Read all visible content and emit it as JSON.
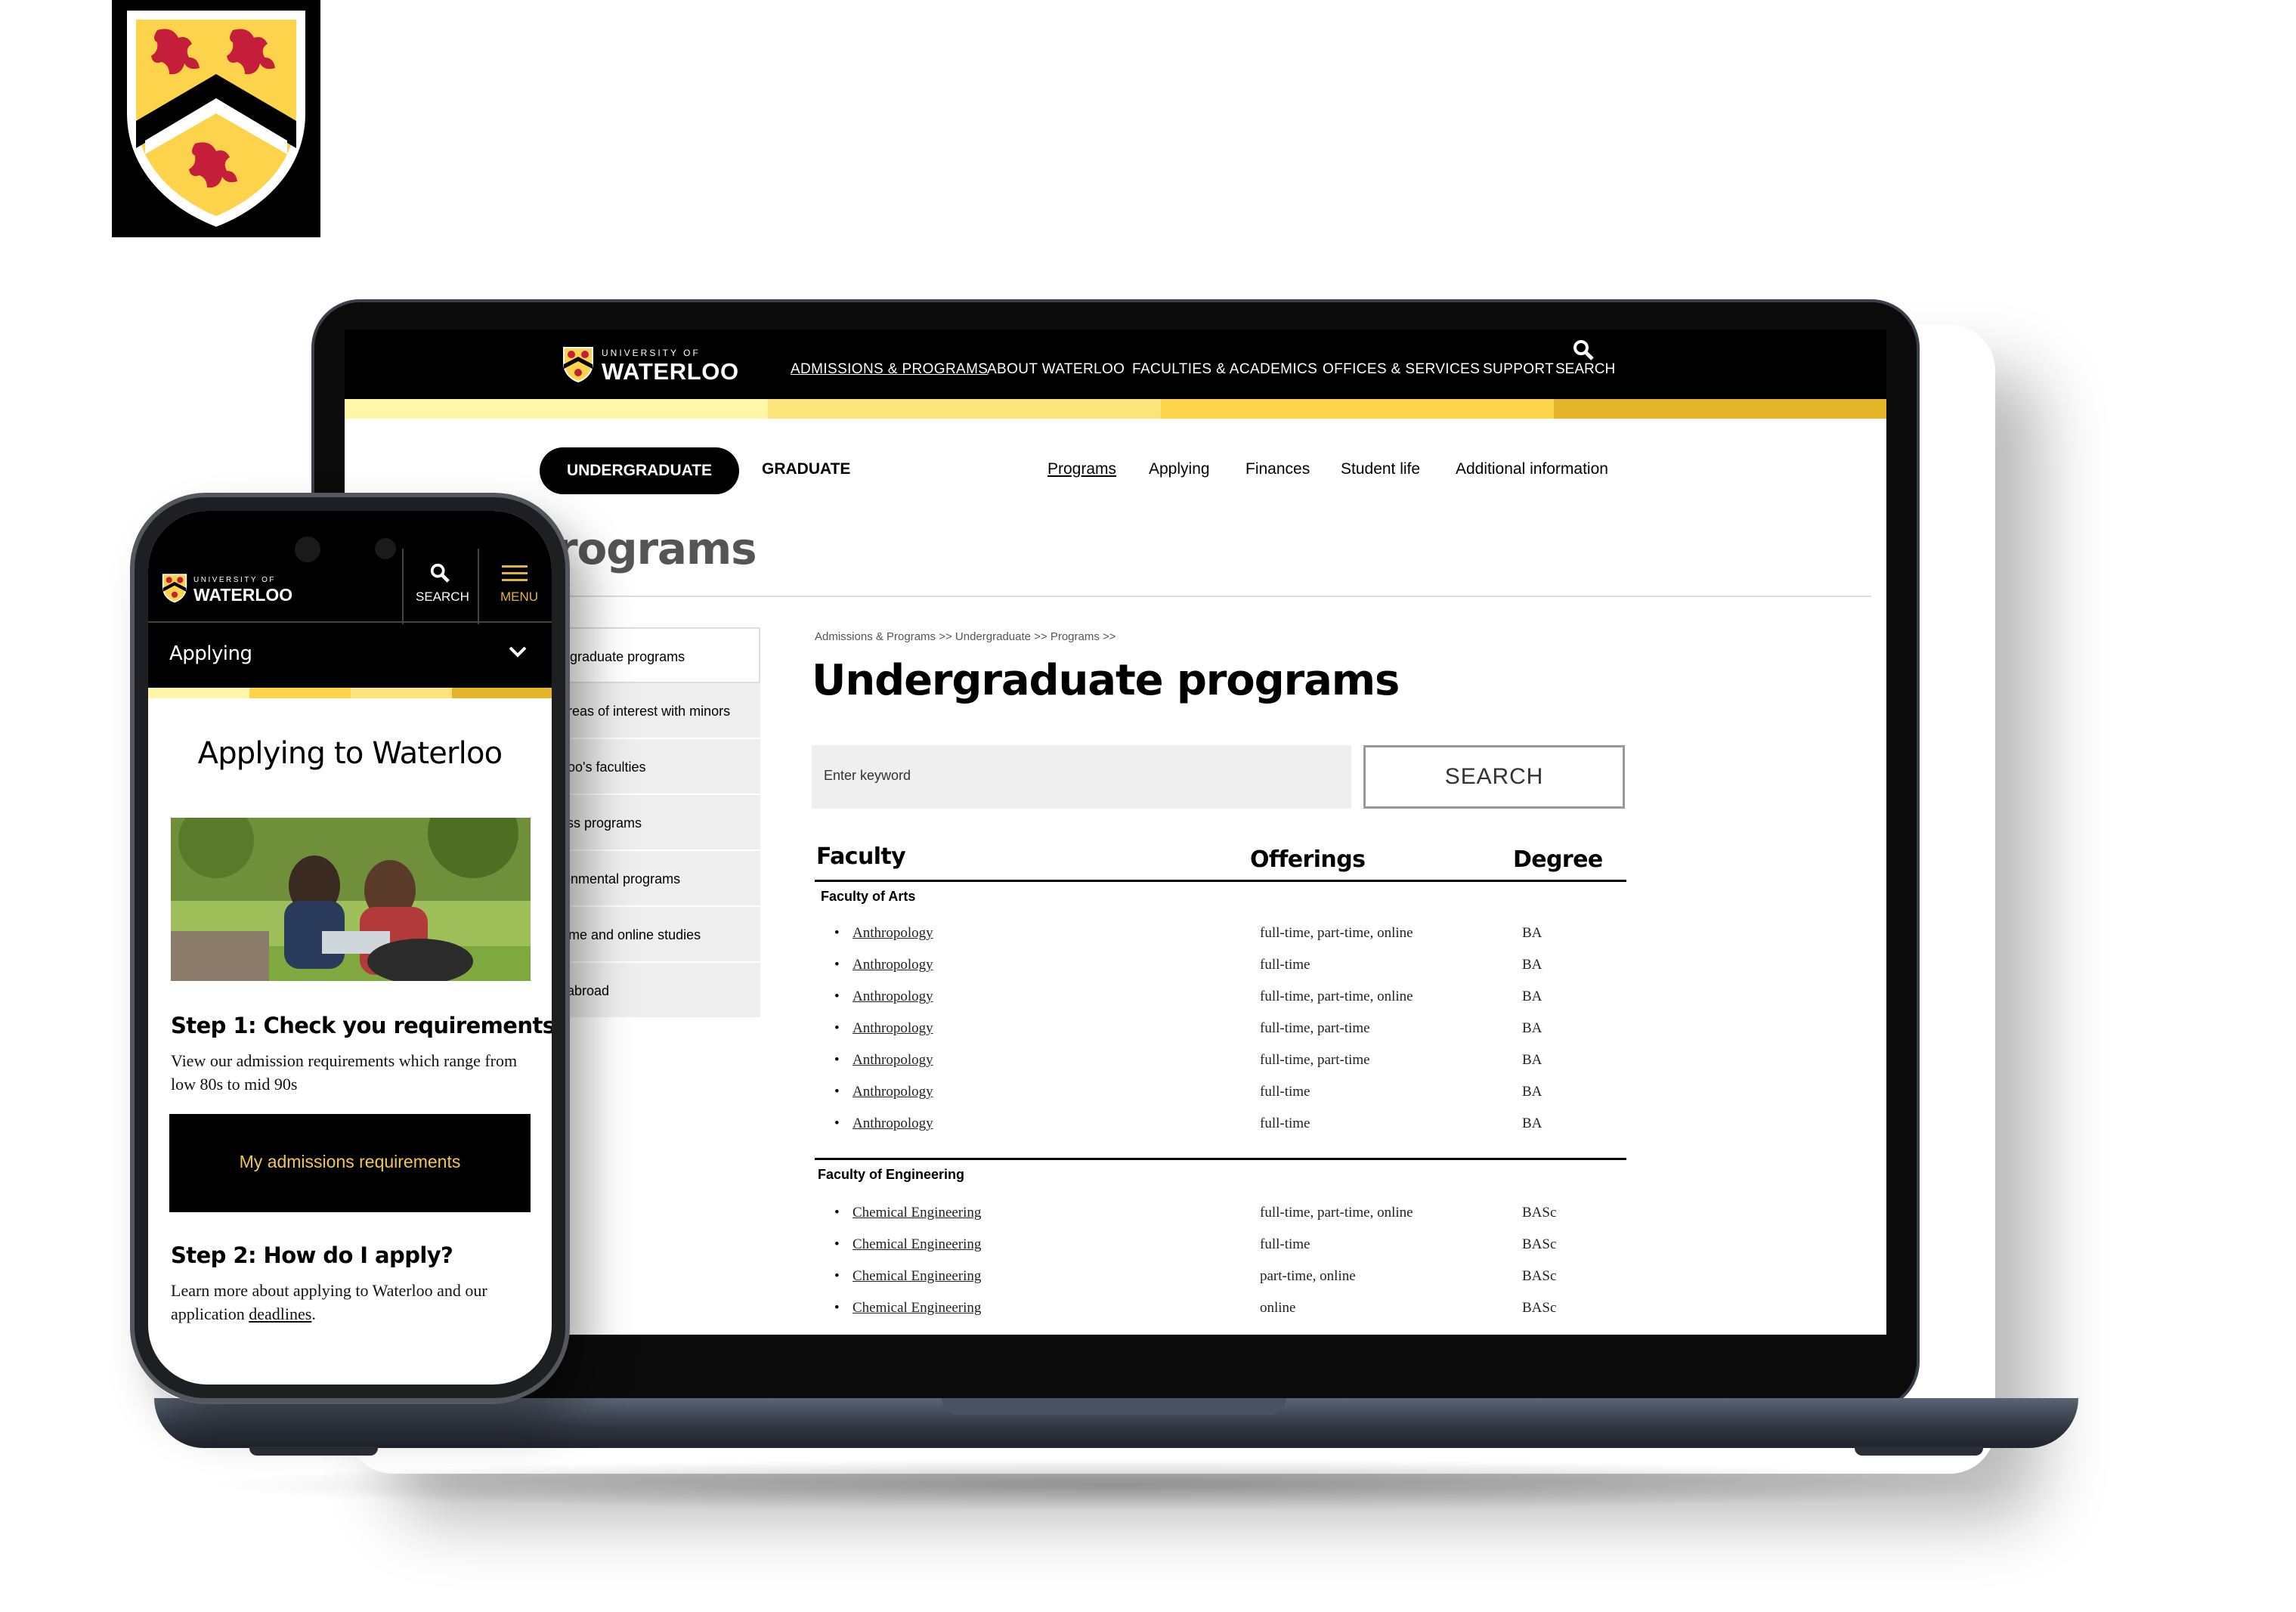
{
  "brand": {
    "university_of": "UNIVERSITY OF",
    "waterloo": "WATERLOO"
  },
  "laptop_header": {
    "nav": [
      "ADMISSIONS & PROGRAMS",
      "ABOUT WATERLOO",
      "FACULTIES & ACADEMICS",
      "OFFICES & SERVICES",
      "SUPPORT"
    ],
    "search_label": "SEARCH"
  },
  "subnav": {
    "undergraduate": "UNDERGRADUATE",
    "graduate": "GRADUATE",
    "links": [
      "Programs",
      "Applying",
      "Finances",
      "Student life",
      "Additional information"
    ]
  },
  "page": {
    "heading_partial": "rograms",
    "side_menu": [
      "dergraduate programs",
      "d areas of interest with minors",
      "terloo's faculties",
      "iness programs",
      "vironmental programs",
      "rt-time and online studies",
      "dy abroad"
    ],
    "breadcrumb": "Admissions & Programs >> Undergraduate >> Programs >>",
    "title": "Undergraduate programs",
    "search_placeholder": "Enter keyword",
    "search_button": "SEARCH"
  },
  "table": {
    "headers": {
      "faculty": "Faculty",
      "offerings": "Offerings",
      "degree": "Degree"
    },
    "groups": [
      {
        "name": "Faculty of Arts",
        "rows": [
          {
            "program": "Anthropology",
            "offerings": "full-time, part-time, online",
            "degree": "BA"
          },
          {
            "program": "Anthropology",
            "offerings": "full-time",
            "degree": "BA"
          },
          {
            "program": "Anthropology",
            "offerings": "full-time, part-time, online",
            "degree": "BA"
          },
          {
            "program": "Anthropology",
            "offerings": "full-time, part-time",
            "degree": "BA"
          },
          {
            "program": "Anthropology",
            "offerings": "full-time, part-time",
            "degree": "BA"
          },
          {
            "program": "Anthropology",
            "offerings": "full-time",
            "degree": "BA"
          },
          {
            "program": "Anthropology",
            "offerings": "full-time",
            "degree": "BA"
          }
        ]
      },
      {
        "name": "Faculty of Engineering",
        "rows": [
          {
            "program": "Chemical Engineering",
            "offerings": "full-time, part-time, online",
            "degree": "BASc"
          },
          {
            "program": "Chemical Engineering",
            "offerings": "full-time",
            "degree": "BASc"
          },
          {
            "program": "Chemical Engineering",
            "offerings": "part-time, online",
            "degree": "BASc"
          },
          {
            "program": "Chemical Engineering",
            "offerings": "online",
            "degree": "BASc"
          }
        ]
      }
    ]
  },
  "phone": {
    "search_label": "SEARCH",
    "menu_label": "MENU",
    "dropdown_label": "Applying",
    "title": "Applying to Waterloo",
    "step1_title": "Step 1: Check you requirements",
    "step1_text": "View our admission requirements which range from low 80s to mid 90s",
    "cta": "My admissions requirements",
    "step2_title": "Step 2: How do I apply?",
    "step2_text_before": "Learn more about applying to Waterloo and our application ",
    "step2_link": "deadlines",
    "step2_text_after": "."
  },
  "colors": {
    "black": "#000000",
    "gold": "#e4b429",
    "yellow": "#fed34c",
    "pale_yellow": "#fff6a8",
    "shield_red": "#c41e3a",
    "cta_text": "#f2c94c"
  }
}
